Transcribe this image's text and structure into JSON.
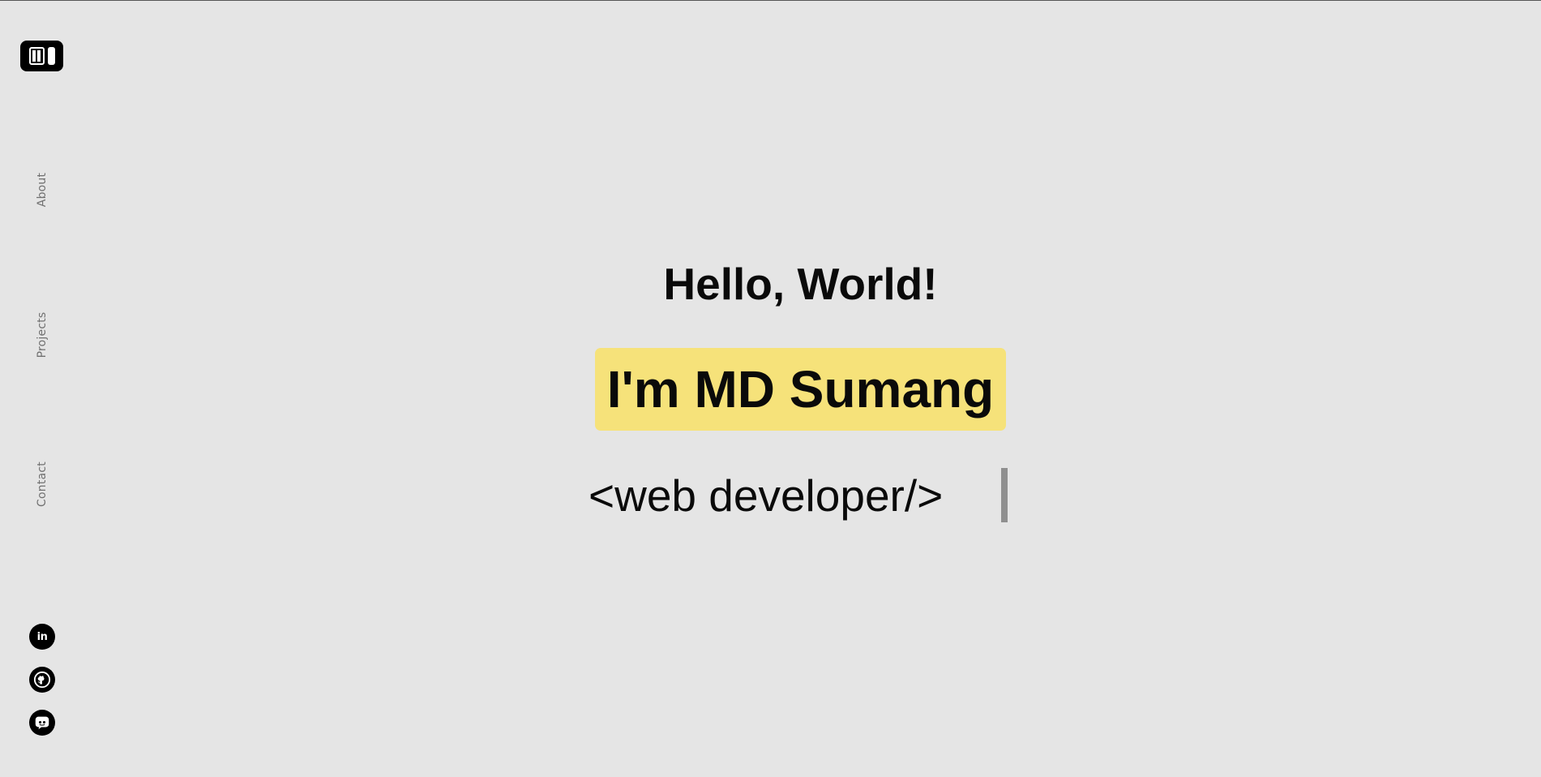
{
  "nav": {
    "about": "About",
    "projects": "Projects",
    "contact": "Contact"
  },
  "social": {
    "linkedin_glyph": "in"
  },
  "hero": {
    "greeting": "Hello, World!",
    "name": "I'm MD Sumang",
    "role": "<web developer/>"
  },
  "colors": {
    "background": "#e5e5e5",
    "highlight": "#f6e27a",
    "text": "#0a0a0a",
    "nav_text": "#707070",
    "cursor": "#8f8f8f"
  },
  "icons": {
    "logo": "logo-icon",
    "linkedin": "linkedin-icon",
    "github": "github-icon",
    "discord": "discord-icon"
  }
}
